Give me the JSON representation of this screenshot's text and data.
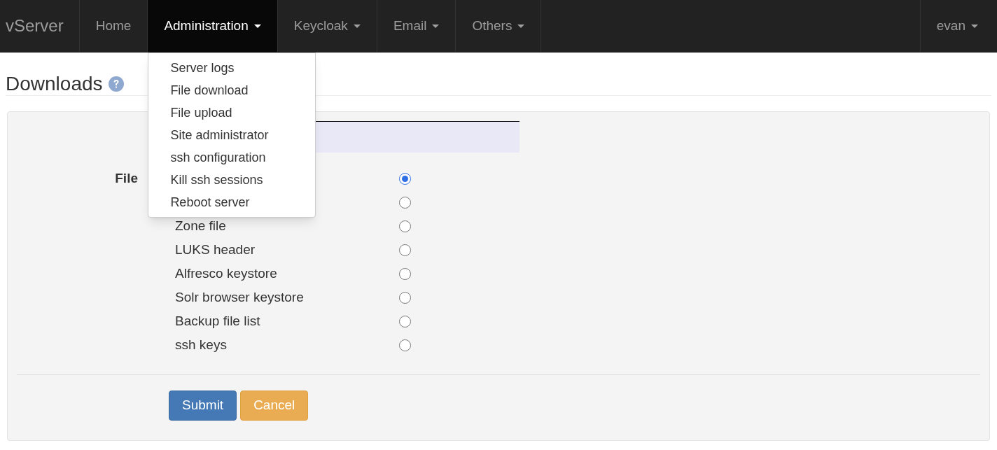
{
  "navbar": {
    "brand": "vServer",
    "items": [
      {
        "label": "Home",
        "selected": false,
        "dropdown": false
      },
      {
        "label": "Administration",
        "selected": true,
        "dropdown": true
      },
      {
        "label": "Keycloak",
        "selected": false,
        "dropdown": true
      },
      {
        "label": "Email",
        "selected": false,
        "dropdown": true
      },
      {
        "label": "Others",
        "selected": false,
        "dropdown": true
      }
    ],
    "user_menu": {
      "label": "evan"
    }
  },
  "dropdown_menu": [
    "Server logs",
    "File download",
    "File upload",
    "Site administrator",
    "ssh configuration",
    "Kill ssh sessions",
    "Reboot server"
  ],
  "page": {
    "title": "Downloads"
  },
  "form": {
    "field_label": "File",
    "options": [
      {
        "selected": true
      },
      {
        "selected": false
      },
      {
        "label": "Zone file",
        "selected": false
      },
      {
        "label": "LUKS header",
        "selected": false
      },
      {
        "label": "Alfresco keystore",
        "selected": false
      },
      {
        "label": "Solr browser keystore",
        "selected": false
      },
      {
        "label": "Backup file list",
        "selected": false
      },
      {
        "label": "ssh keys",
        "selected": false
      }
    ],
    "buttons": [
      {
        "label": "Submit",
        "kind": "primary"
      },
      {
        "label": "Cancel",
        "kind": "warning"
      }
    ]
  }
}
